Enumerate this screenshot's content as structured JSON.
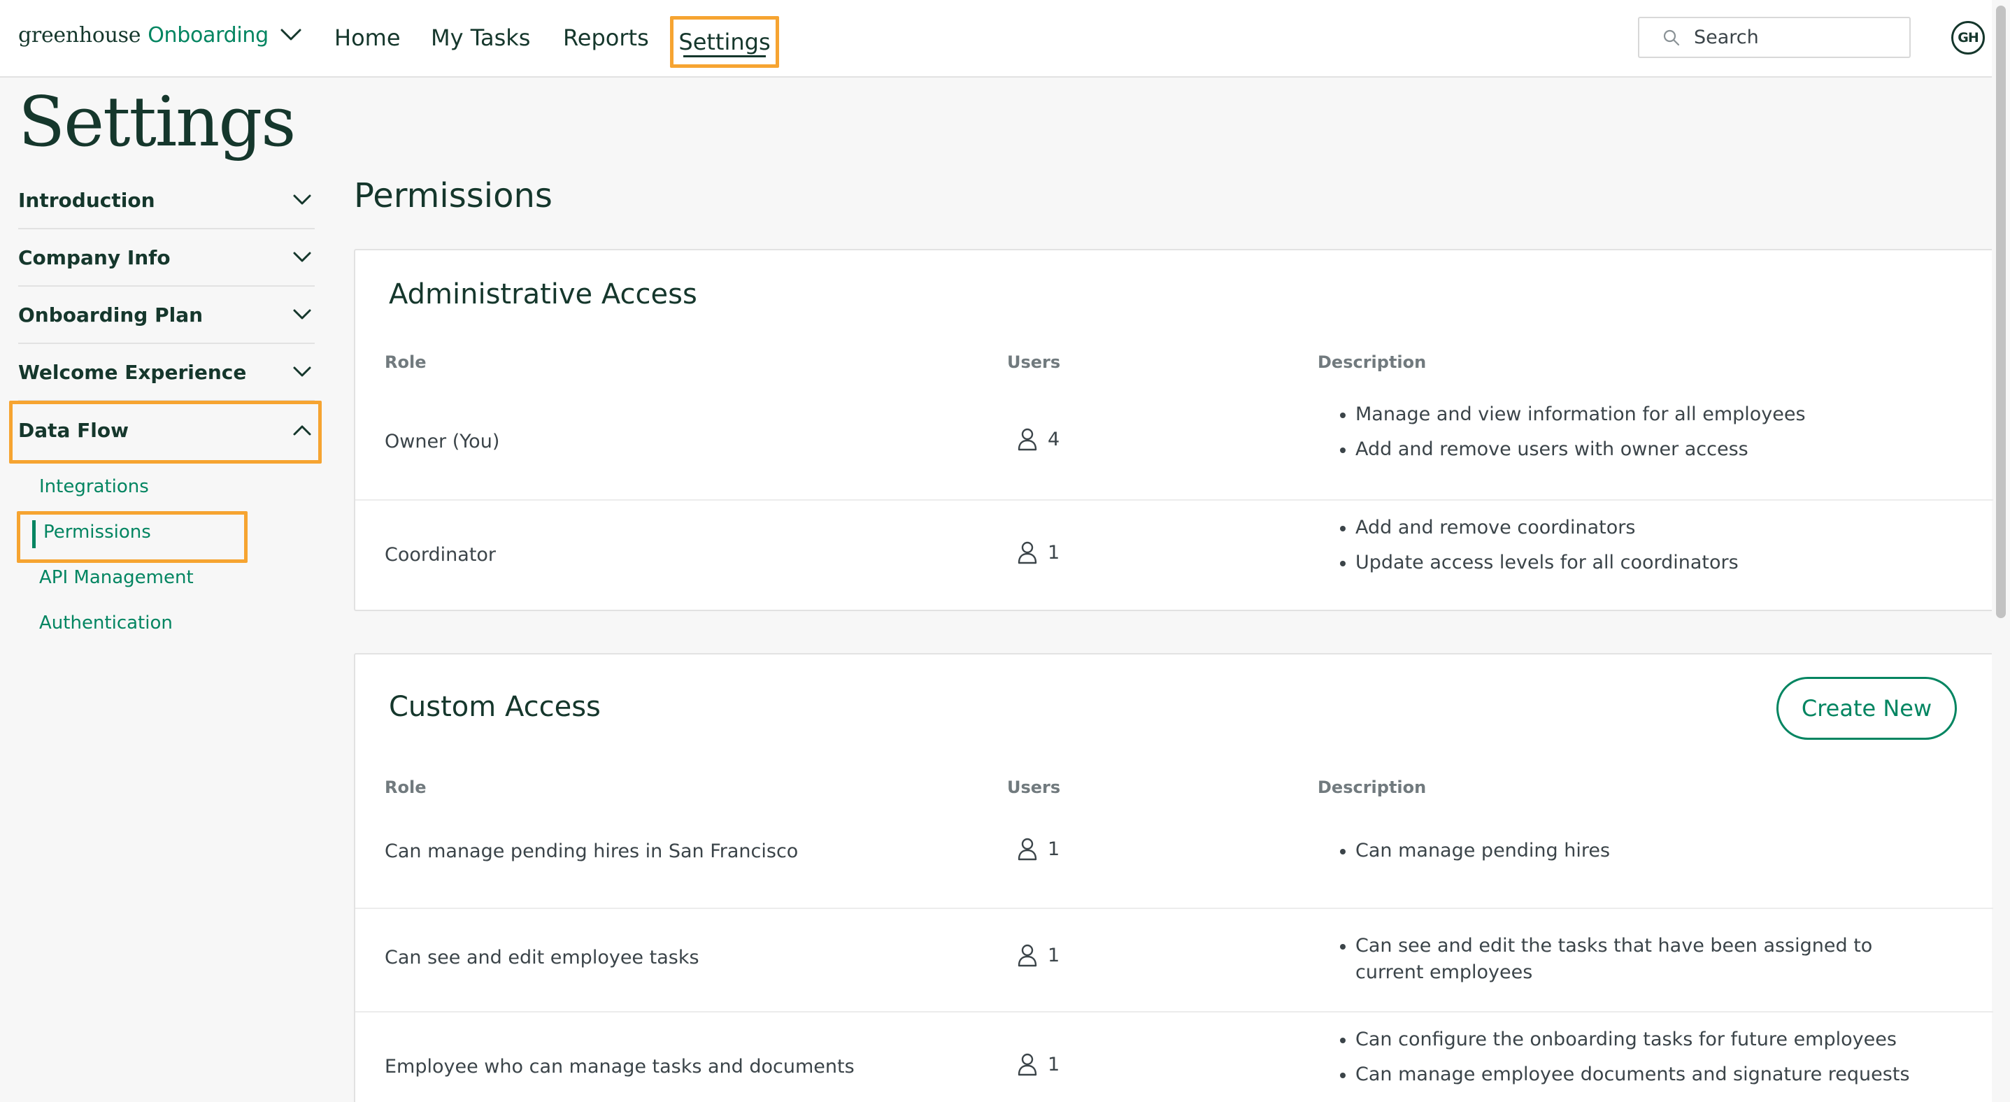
{
  "topnav": {
    "brand_name": "greenhouse",
    "brand_product": "Onboarding",
    "items": [
      "Home",
      "My Tasks",
      "Reports",
      "Settings"
    ],
    "active": "Settings",
    "search_placeholder": "Search",
    "avatar_initials": "GH"
  },
  "page": {
    "title": "Settings"
  },
  "sidebar": {
    "sections": [
      {
        "label": "Introduction",
        "expanded": false
      },
      {
        "label": "Company Info",
        "expanded": false
      },
      {
        "label": "Onboarding Plan",
        "expanded": false
      },
      {
        "label": "Welcome Experience",
        "expanded": false
      },
      {
        "label": "Data Flow",
        "expanded": true
      }
    ],
    "sub_items": [
      "Integrations",
      "Permissions",
      "API Management",
      "Authentication"
    ],
    "current_sub_item": "Permissions"
  },
  "main": {
    "title": "Permissions",
    "columns": {
      "role": "Role",
      "users": "Users",
      "description": "Description"
    },
    "administrative": {
      "title": "Administrative Access",
      "rows": [
        {
          "role": "Owner (You)",
          "users": "4",
          "description": [
            "Manage and view information for all employees",
            "Add and remove users with owner access"
          ]
        },
        {
          "role": "Coordinator",
          "users": "1",
          "description": [
            "Add and remove coordinators",
            "Update access levels for all coordinators"
          ]
        }
      ]
    },
    "custom": {
      "title": "Custom Access",
      "create_label": "Create New",
      "rows": [
        {
          "role": "Can manage pending hires in San Francisco",
          "users": "1",
          "description": [
            "Can manage pending hires"
          ]
        },
        {
          "role": "Can see and edit employee tasks",
          "users": "1",
          "description": [
            "Can see and edit the tasks that have been assigned to current employees"
          ]
        },
        {
          "role": "Employee who can manage tasks and documents",
          "users": "1",
          "description": [
            "Can configure the onboarding tasks for future employees",
            "Can manage employee documents and signature requests"
          ]
        }
      ]
    }
  },
  "colors": {
    "brand_green": "#038561",
    "dark_green": "#15372c",
    "highlight": "#f6a431"
  }
}
